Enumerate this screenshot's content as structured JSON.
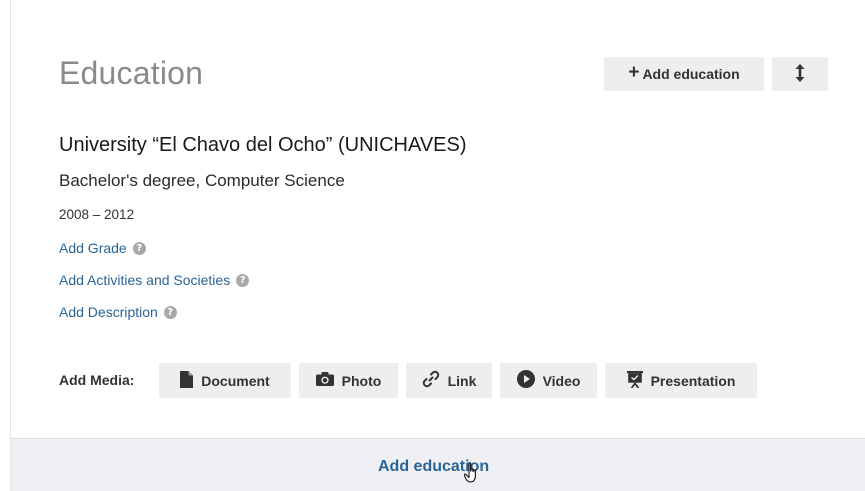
{
  "section": {
    "title": "Education",
    "add_button_label": "Add education",
    "reorder_icon": "vertical-arrows-icon"
  },
  "entry": {
    "school": "University “El Chavo del Ocho” (UNICHAVES)",
    "degree": "Bachelor's degree, Computer Science",
    "dates": "2008 – 2012",
    "links": [
      {
        "label": "Add Grade",
        "icon": "help-icon"
      },
      {
        "label": "Add Activities and Societies",
        "icon": "help-icon"
      },
      {
        "label": "Add Description",
        "icon": "help-icon"
      }
    ]
  },
  "media": {
    "label": "Add Media:",
    "buttons": [
      {
        "label": "Document",
        "icon": "document-icon"
      },
      {
        "label": "Photo",
        "icon": "camera-icon"
      },
      {
        "label": "Link",
        "icon": "link-icon"
      },
      {
        "label": "Video",
        "icon": "play-icon"
      },
      {
        "label": "Presentation",
        "icon": "presentation-icon"
      }
    ]
  },
  "footer": {
    "add_link_label": "Add education"
  },
  "colors": {
    "link": "#2a6496",
    "button_bg": "#eeeeee",
    "footer_bg": "#eef0f3",
    "title_gray": "#8a8a8a"
  }
}
